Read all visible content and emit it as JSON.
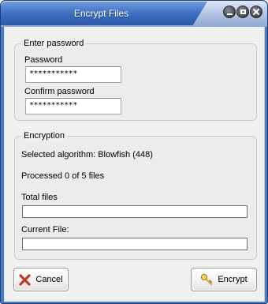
{
  "window": {
    "title": "Encrypt Files",
    "controls": [
      "minimize-icon",
      "maximize-icon",
      "close-icon"
    ]
  },
  "password_group": {
    "legend": "Enter password",
    "password_label": "Password",
    "password_value": "***********",
    "confirm_label": "Confirm password",
    "confirm_value": "***********"
  },
  "encryption_group": {
    "legend": "Encryption",
    "algorithm_text": "Selected algorithm: Blowfish (448)",
    "processed_text": "Processed 0 of 5 files",
    "total_files_label": "Total files",
    "total_files_progress": 0,
    "current_file_label": "Current File:",
    "current_file_progress": 0
  },
  "buttons": {
    "cancel_label": "Cancel",
    "cancel_icon": "red-x-icon",
    "encrypt_label": "Encrypt",
    "encrypt_icon": "key-icon"
  },
  "colors": {
    "title_bar": "#3c6cbf",
    "frame": "#4a7cc4",
    "cancel_icon": "#c0392b",
    "key_icon": "#e8b923"
  }
}
